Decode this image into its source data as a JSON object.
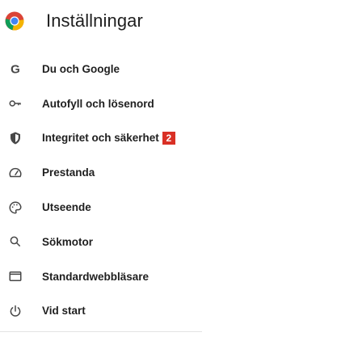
{
  "app": {
    "title": "Inställningar",
    "logo": "chrome-logo-icon"
  },
  "colors": {
    "badge": "#d93025",
    "icon": "#474747",
    "text": "#1f1f1f"
  },
  "sidebar": {
    "items": [
      {
        "label": "Du och Google",
        "icon": "google-g-icon"
      },
      {
        "label": "Autofyll och lösenord",
        "icon": "key-icon"
      },
      {
        "label": "Integritet och säkerhet",
        "icon": "shield-icon",
        "badge": "2"
      },
      {
        "label": "Prestanda",
        "icon": "speedometer-icon"
      },
      {
        "label": "Utseende",
        "icon": "palette-icon"
      },
      {
        "label": "Sökmotor",
        "icon": "search-icon"
      },
      {
        "label": "Standardwebbläsare",
        "icon": "browser-window-icon"
      },
      {
        "label": "Vid start",
        "icon": "power-icon"
      }
    ]
  }
}
